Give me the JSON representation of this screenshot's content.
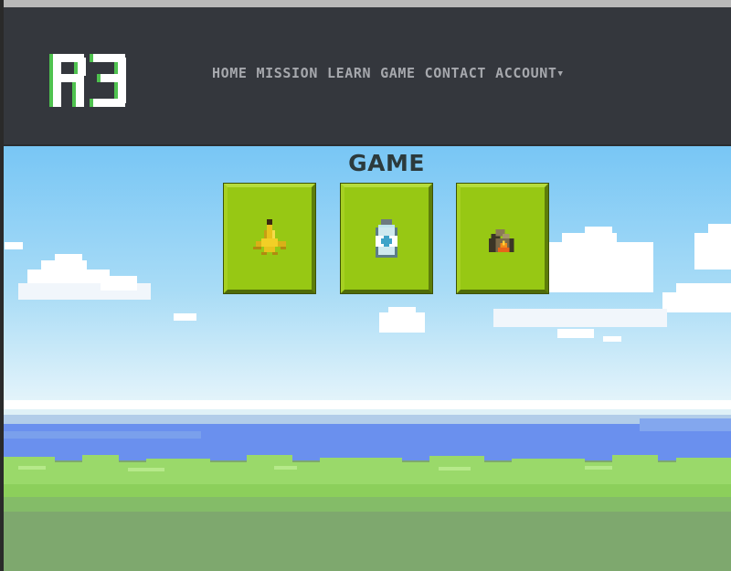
{
  "header": {
    "logo_text": "R3",
    "nav": [
      {
        "label": "HOME"
      },
      {
        "label": "MISSION"
      },
      {
        "label": "LEARN"
      },
      {
        "label": "GAME"
      },
      {
        "label": "CONTACT"
      },
      {
        "label": "ACCOUNT",
        "has_dropdown": true
      }
    ]
  },
  "game": {
    "title": "GAME",
    "items": [
      {
        "icon": "banana-peel-icon",
        "kind": "compost"
      },
      {
        "icon": "plastic-bottle-icon",
        "kind": "recycle"
      },
      {
        "icon": "burning-box-icon",
        "kind": "landfill"
      }
    ]
  },
  "colors": {
    "header_bg": "#34373d",
    "nav_text": "#a6a8ad",
    "logo_white": "#ffffff",
    "logo_green": "#4fc24f",
    "card_green": "#97c814",
    "sky_top": "#78c6f5",
    "sea": "#6a90ee",
    "grass": "#9ad96a",
    "ground": "#7ea86e"
  }
}
